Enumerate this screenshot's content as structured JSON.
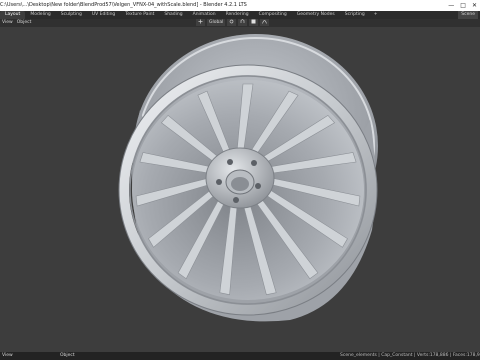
{
  "window": {
    "title": "C:\\Users\\...\\Desktop\\New folder\\BlendProd57\\Velgen_VFNX-04_withScale.blend] - Blender 4.2.1 LTS",
    "minimize_glyph": "—",
    "maximize_glyph": "□",
    "close_glyph": "✕"
  },
  "menubar": {
    "tabs": [
      "Layout",
      "Modeling",
      "Sculpting",
      "UV Editing",
      "Texture Paint",
      "Shading",
      "Animation",
      "Rendering",
      "Compositing",
      "Geometry Nodes",
      "Scripting"
    ],
    "active_tab": "Layout",
    "add_tab": "+",
    "scene": "Scene",
    "view_layer": "ViewLayer"
  },
  "header": {
    "mode": "Object Mode",
    "menu_left": "View",
    "menu_object": "Object",
    "transform": "Global",
    "options": "Options"
  },
  "status": {
    "left": "View",
    "object": "Object",
    "stats": "Scene_elements | Cap_Constant | Verts:178,886 | Faces:178,944 | Tris:357,888"
  },
  "colors": {
    "wheel_light": "#dde1e6",
    "wheel_mid": "#a9adb3",
    "wheel_dark": "#6e7278",
    "background": "#3d3d3d"
  }
}
